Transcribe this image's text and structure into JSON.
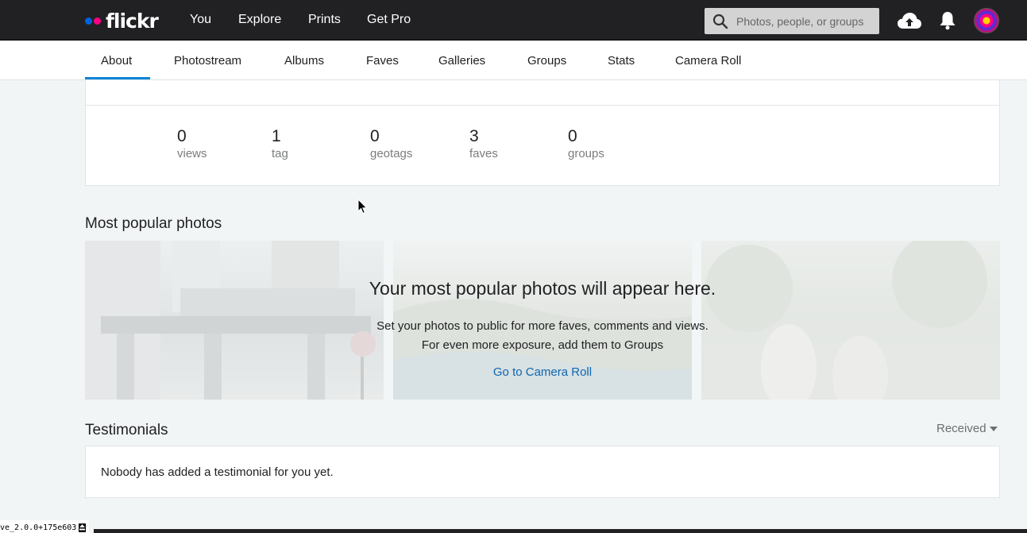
{
  "topnav": {
    "logo": "flickr",
    "links": [
      "You",
      "Explore",
      "Prints",
      "Get Pro"
    ],
    "search_placeholder": "Photos, people, or groups"
  },
  "subnav": {
    "tabs": [
      "About",
      "Photostream",
      "Albums",
      "Faves",
      "Galleries",
      "Groups",
      "Stats",
      "Camera Roll"
    ],
    "active": "About"
  },
  "stats": [
    {
      "num": "0",
      "label": "views"
    },
    {
      "num": "1",
      "label": "tag"
    },
    {
      "num": "0",
      "label": "geotags"
    },
    {
      "num": "3",
      "label": "faves"
    },
    {
      "num": "0",
      "label": "groups"
    }
  ],
  "popular": {
    "title": "Most popular photos",
    "headline": "Your most popular photos will appear here.",
    "line1": "Set your photos to public for more faves, comments and views.",
    "line2": "For even more exposure, add them to Groups",
    "link": "Go to Camera Roll"
  },
  "testimonials": {
    "title": "Testimonials",
    "filter": "Received",
    "empty": "Nobody has added a testimonial for you yet."
  },
  "footer": {
    "version": "ve_2.0.0+175e603"
  },
  "colors": {
    "topbar": "#212124",
    "accent": "#0a84d6",
    "link": "#1066b0",
    "brand_blue": "#0063dc",
    "brand_pink": "#ff0084"
  }
}
